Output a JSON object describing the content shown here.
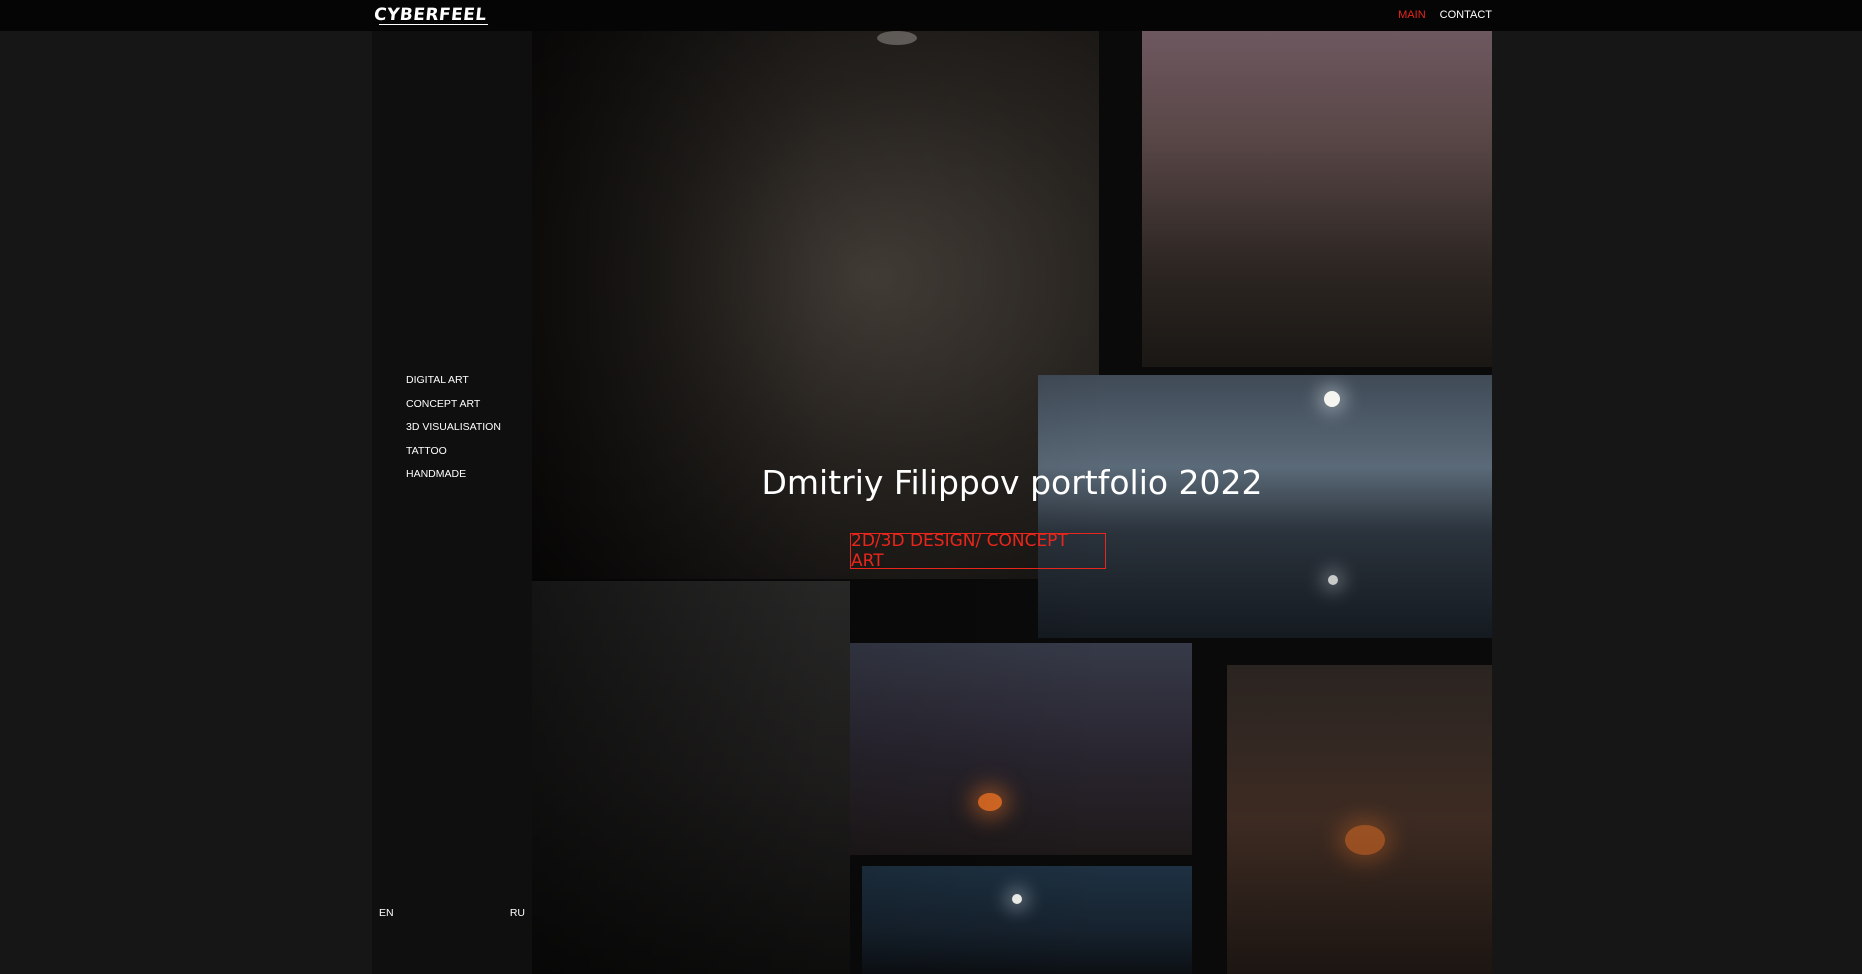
{
  "header": {
    "logo": "CYBERFEEL",
    "nav": [
      {
        "label": "MAIN",
        "active": true
      },
      {
        "label": "CONTACT",
        "active": false
      }
    ]
  },
  "sidebar": {
    "menu": [
      {
        "label": "DIGITAL ART"
      },
      {
        "label": "CONCEPT ART"
      },
      {
        "label": "3D VISUALISATION"
      },
      {
        "label": "TATTOO"
      },
      {
        "label": "HANDMADE"
      }
    ],
    "lang": {
      "en": "EN",
      "ru": "RU"
    }
  },
  "hero": {
    "title": "Dmitriy Filippov portfolio 2022",
    "cta": "2D/3D DESIGN/ CONCEPT ART"
  },
  "colors": {
    "accent": "#e8261c",
    "background": "#161616",
    "sidebar": "#0f0f0f"
  }
}
